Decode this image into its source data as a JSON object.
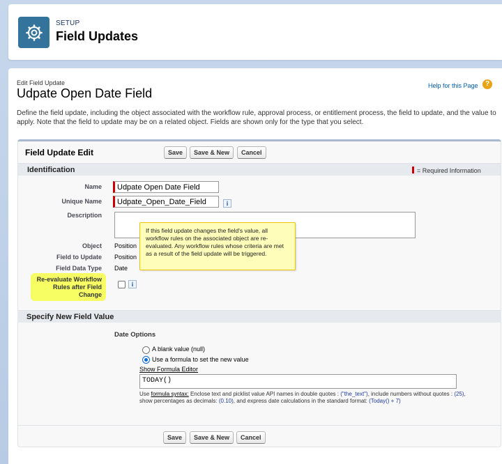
{
  "header": {
    "section_label": "SETUP",
    "title": "Field Updates"
  },
  "page": {
    "edit_label": "Edit Field Update",
    "record_title": "Udpate Open Date Field",
    "help_link": "Help for this Page",
    "help_icon": "?",
    "description": "Define the field update, including the object associated with the workflow rule, approval process, or entitlement process, the field to update, and the value to apply. Note that the field to update may be on a related object. Fields are shown only for the type that you select."
  },
  "panel": {
    "title": "Field Update Edit",
    "buttons": {
      "save": "Save",
      "save_new": "Save & New",
      "cancel": "Cancel"
    }
  },
  "identification": {
    "heading": "Identification",
    "required_legend": "= Required Information",
    "name_label": "Name",
    "name_value": "Udpate Open Date Field",
    "unique_name_label": "Unique Name",
    "unique_name_value": "Udpate_Open_Date_Field",
    "description_label": "Description",
    "description_value": "",
    "object_label": "Object",
    "object_value": "Position",
    "field_to_update_label": "Field to Update",
    "field_to_update_value": "Position",
    "field_data_type_label": "Field Data Type",
    "field_data_type_value": "Date",
    "reevaluate_label": "Re-evaluate Workflow Rules after Field Change",
    "reevaluate_checked": false,
    "info_icon": "i",
    "tooltip": "If this field update changes the field's value, all workflow rules on the associated object are re-evaluated. Any workflow rules whose criteria are met as a result of the field update will be triggered."
  },
  "new_value": {
    "heading": "Specify New Field Value",
    "date_options_label": "Date Options",
    "option_blank": "A blank value (null)",
    "option_formula": "Use a formula to set the new value",
    "selected_option": "formula",
    "formula_editor_link": "Show Formula Editor",
    "formula_value": "TODAY()",
    "syntax_use": "Use",
    "syntax_link": "formula syntax:",
    "syntax_part1": "Enclose text and picklist value API names in double quotes :",
    "syntax_ex1": "(\"the_text\")",
    "syntax_part2": ", include numbers without quotes :",
    "syntax_ex2": "(25)",
    "syntax_part3": ", show percentages as decimals:",
    "syntax_ex3": "(0.10)",
    "syntax_part4": ", and express date calculations in the standard format:",
    "syntax_ex4": "(Today() + 7)"
  },
  "colors": {
    "setup_icon_bg": "#34739c",
    "required_bar": "#cc0000",
    "tooltip_bg": "#fefdb9",
    "highlight": "#f6ff4a",
    "link": "#015ba7"
  }
}
